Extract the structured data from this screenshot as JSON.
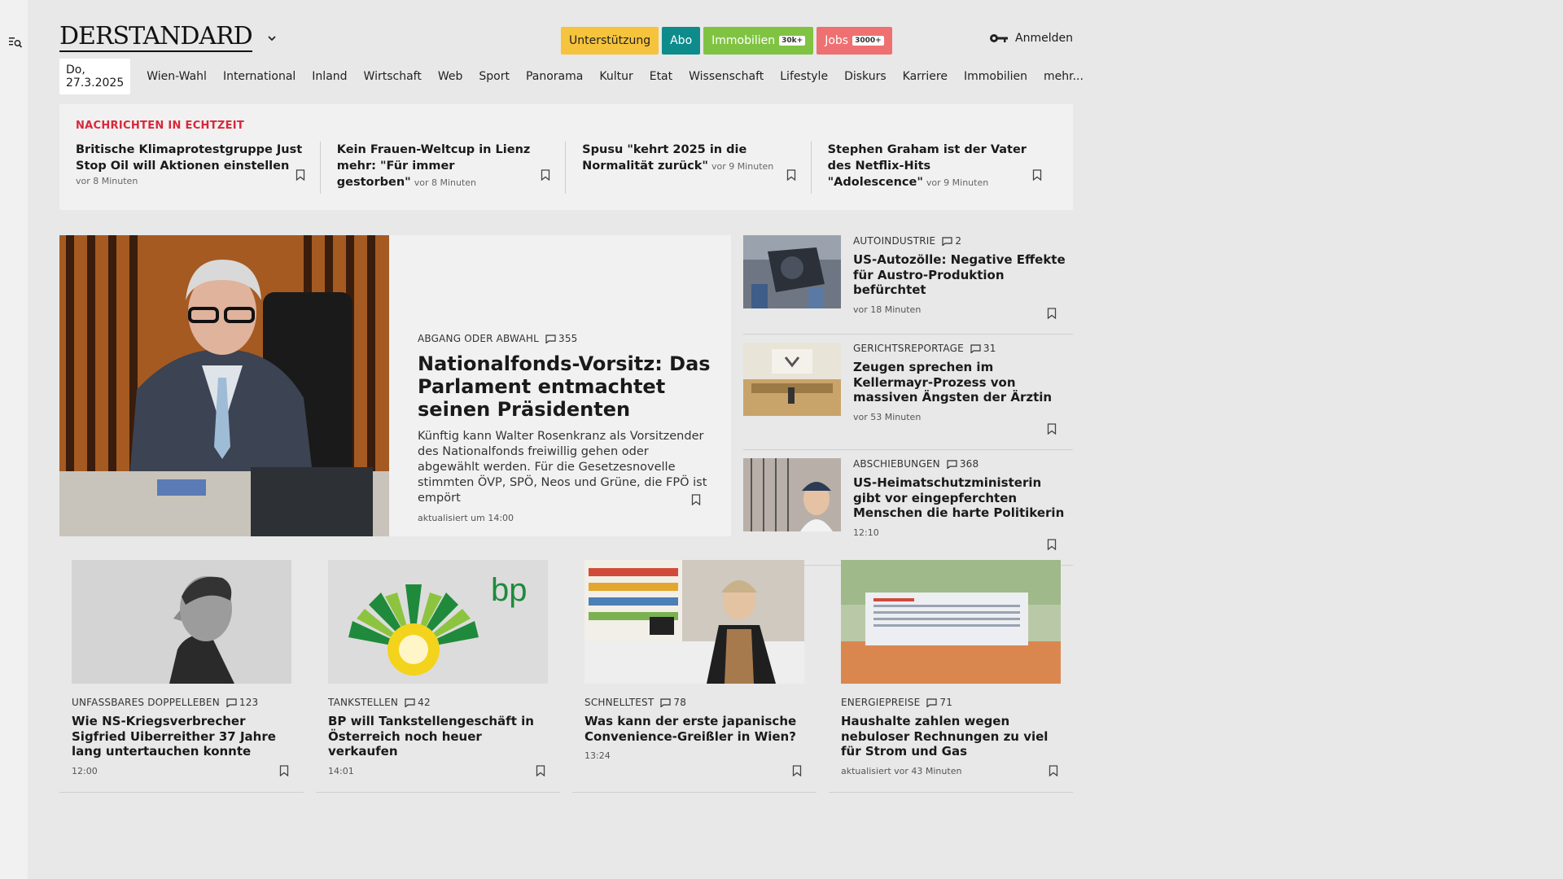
{
  "brand": {
    "logo": "DERSTANDARD"
  },
  "header": {
    "promo": [
      {
        "label": "Unterstützung",
        "badge": ""
      },
      {
        "label": "Abo",
        "badge": ""
      },
      {
        "label": "Immobilien",
        "badge": "30k+"
      },
      {
        "label": "Jobs",
        "badge": "3000+"
      }
    ],
    "login_label": "Anmelden"
  },
  "nav": {
    "date": "Do, 27.3.2025",
    "items": [
      "Wien-Wahl",
      "International",
      "Inland",
      "Wirtschaft",
      "Web",
      "Sport",
      "Panorama",
      "Kultur",
      "Etat",
      "Wissenschaft",
      "Lifestyle",
      "Diskurs",
      "Karriere",
      "Immobilien",
      "mehr..."
    ]
  },
  "ticker": {
    "title": "NACHRICHTEN IN ECHTZEIT",
    "items": [
      {
        "headline": "Britische Klimaprotestgruppe Just Stop Oil will Aktionen einstellen",
        "time": "vor 8 Minuten"
      },
      {
        "headline": "Kein Frauen-Weltcup in Lienz mehr: \"Für immer gestorben\"",
        "time": "vor 8 Minuten"
      },
      {
        "headline": "Spusu \"kehrt 2025 in die Normalität zurück\"",
        "time": "vor 9 Minuten"
      },
      {
        "headline": "Stephen Graham ist der Vater des Netflix-Hits \"Adolescence\"",
        "time": "vor 9 Minuten"
      }
    ]
  },
  "lead": {
    "kicker": "ABGANG ODER ABWAHL",
    "comments": "355",
    "title": "Nationalfonds-Vorsitz: Das Parlament entmachtet seinen Präsidenten",
    "teaser": "Künftig kann Walter Rosenkranz als Vorsitzender des Nationalfonds freiwillig gehen oder abgewählt werden. Für die Gesetzesnovelle stimmten ÖVP, SPÖ, Neos und Grüne, die FPÖ ist empört",
    "time": "aktualisiert um 14:00"
  },
  "side": [
    {
      "kicker": "AUTOINDUSTRIE",
      "comments": "2",
      "title": "US-Autozölle: Negative Effekte für Austro-Produktion befürchtet",
      "time": "vor 18 Minuten"
    },
    {
      "kicker": "GERICHTSREPORTAGE",
      "comments": "31",
      "title": "Zeugen sprechen im Kellermayr-Prozess von massiven Ängsten der Ärztin",
      "time": "vor 53 Minuten"
    },
    {
      "kicker": "ABSCHIEBUNGEN",
      "comments": "368",
      "title": "US-Heimatschutzministerin gibt vor eingepferchten Menschen die harte Politikerin",
      "time": "12:10"
    }
  ],
  "cards": [
    {
      "kicker": "UNFASSBARES DOPPELLEBEN",
      "comments": "123",
      "title": "Wie NS-Kriegsverbrecher Sigfried Uiberreither 37 Jahre lang untertauchen konnte",
      "time": "12:00"
    },
    {
      "kicker": "TANKSTELLEN",
      "comments": "42",
      "title": "BP will Tankstellengeschäft in Österreich noch heuer verkaufen",
      "time": "14:01"
    },
    {
      "kicker": "SCHNELLTEST",
      "comments": "78",
      "title": "Was kann der erste japanische Convenience-Greißler in Wien?",
      "time": "13:24"
    },
    {
      "kicker": "ENERGIEPREISE",
      "comments": "71",
      "title": "Haushalte zahlen wegen nebuloser Rechnungen zu viel für Strom und Gas",
      "time": "aktualisiert vor 43 Minuten"
    }
  ],
  "images": {
    "bp_logo_text": "bp"
  }
}
